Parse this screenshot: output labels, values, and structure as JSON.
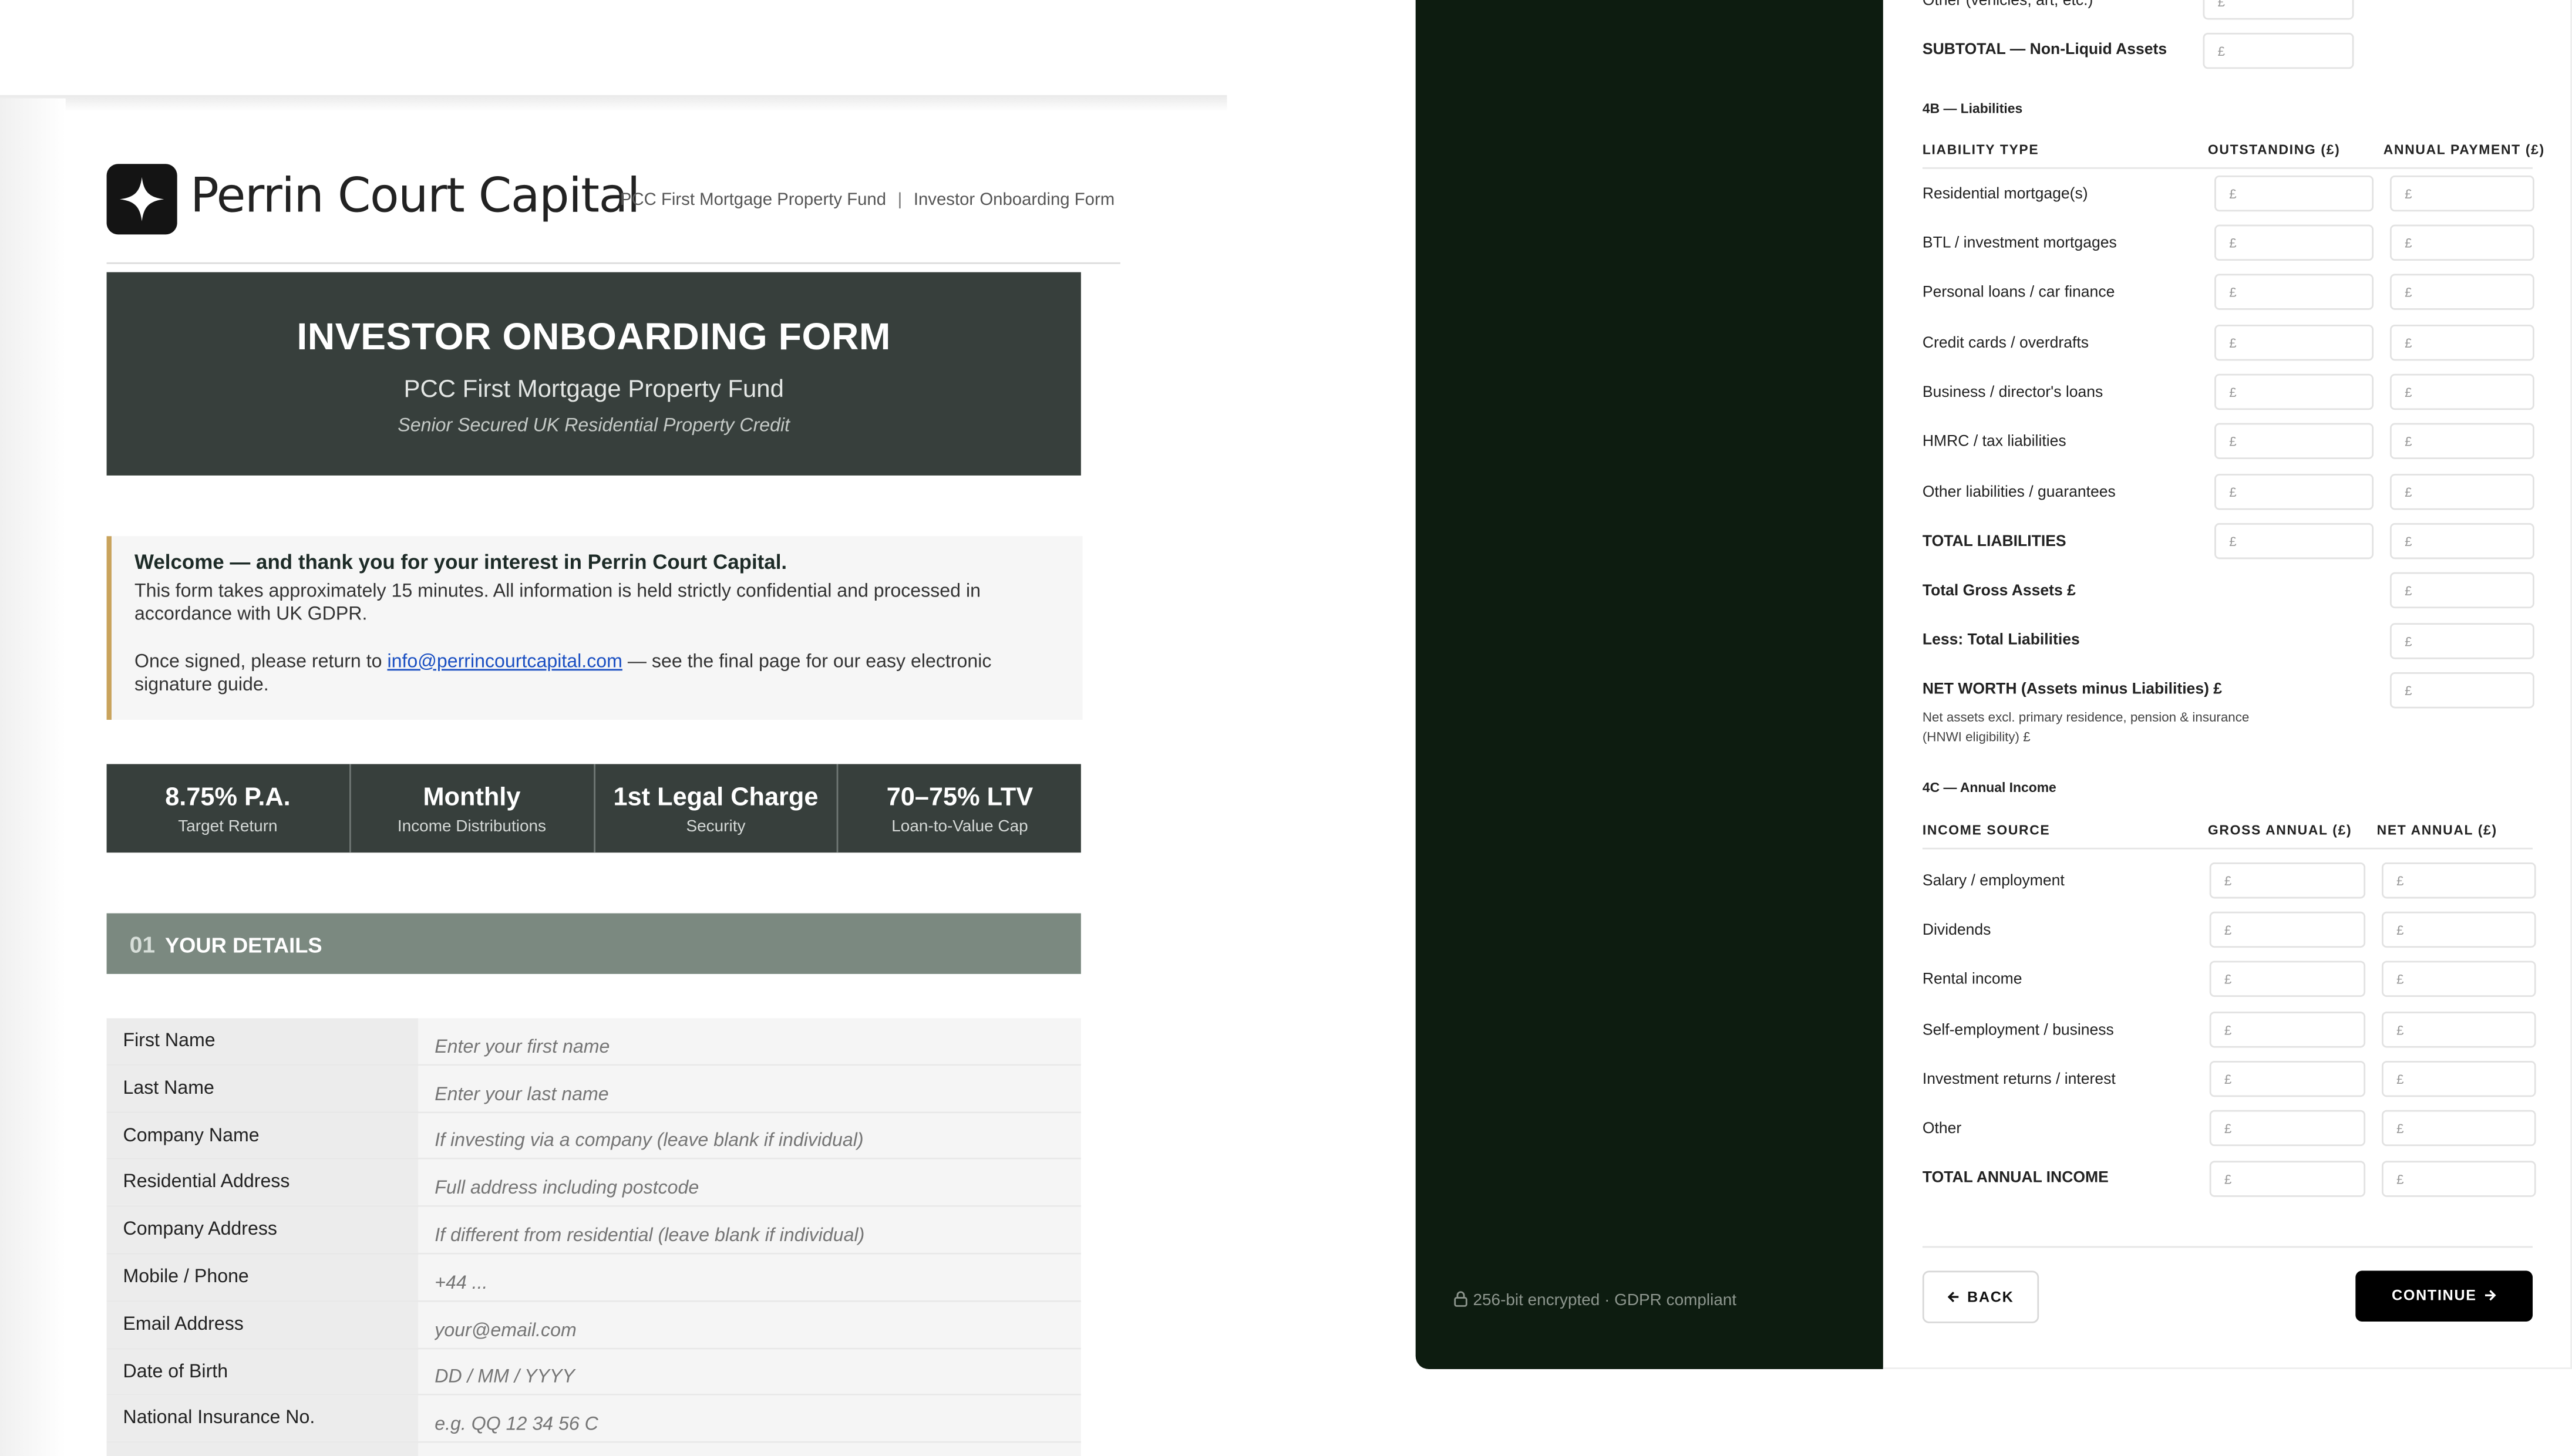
{
  "document": {
    "brand_name": "Perrin Court Capital",
    "header_fund": "PCC First Mortgage Property Fund",
    "header_separator": "|",
    "header_form": "Investor Onboarding Form",
    "banner": {
      "title": "INVESTOR ONBOARDING FORM",
      "subtitle": "PCC First Mortgage Property Fund",
      "tagline": "Senior Secured UK Residential Property Credit"
    },
    "welcome": {
      "heading": "Welcome — and thank you for your interest in Perrin Court Capital.",
      "para1": "This form takes approximately 15 minutes. All information is held strictly confidential and processed in accordance with UK GDPR.",
      "para2_before": "Once signed, please return to ",
      "email": "info@perrincourtcapital.com",
      "para2_after": " — see the final page for our easy electronic signature guide."
    },
    "stats": [
      {
        "value": "8.75% P.A.",
        "label": "Target Return"
      },
      {
        "value": "Monthly",
        "label": "Income Distributions"
      },
      {
        "value": "1st Legal Charge",
        "label": "Security"
      },
      {
        "value": "70–75% LTV",
        "label": "Loan-to-Value Cap"
      }
    ],
    "section": {
      "number": "01",
      "title": "YOUR DETAILS"
    },
    "fields": [
      {
        "label": "First Name",
        "placeholder": "Enter your first name"
      },
      {
        "label": "Last Name",
        "placeholder": "Enter your last name"
      },
      {
        "label": "Company Name",
        "placeholder": "If investing via a company (leave blank if individual)"
      },
      {
        "label": "Residential Address",
        "placeholder": "Full address including postcode"
      },
      {
        "label": "Company Address",
        "placeholder": "If different from residential (leave blank if individual)"
      },
      {
        "label": "Mobile / Phone",
        "placeholder": "+44 ..."
      },
      {
        "label": "Email Address",
        "placeholder": "your@email.com"
      },
      {
        "label": "Date of Birth",
        "placeholder": "DD / MM / YYYY"
      },
      {
        "label": "National Insurance No.",
        "placeholder": "e.g. QQ 12 34 56 C"
      }
    ]
  },
  "panel": {
    "security_note": "256-bit encrypted · GDPR compliant",
    "currency": "£",
    "top_row_label": "Other (vehicles, art, etc.)",
    "subtotal_label": "SUBTOTAL — Non-Liquid Assets",
    "liabilities": {
      "heading": "4B — Liabilities",
      "col_type": "LIABILITY TYPE",
      "col_outstanding": "OUTSTANDING (£)",
      "col_payment": "ANNUAL PAYMENT (£)",
      "rows": [
        "Residential mortgage(s)",
        "BTL / investment mortgages",
        "Personal loans / car finance",
        "Credit cards / overdrafts",
        "Business / director's loans",
        "HMRC / tax liabilities",
        "Other liabilities / guarantees"
      ],
      "total_label": "TOTAL LIABILITIES"
    },
    "summary": {
      "gross_assets": "Total Gross Assets £",
      "less_liabilities": "Less: Total Liabilities",
      "net_worth": "NET WORTH (Assets minus Liabilities) £",
      "net_note": "Net assets excl. primary residence, pension & insurance (HNWI eligibility) £"
    },
    "income": {
      "heading": "4C — Annual Income",
      "col_source": "INCOME SOURCE",
      "col_gross": "GROSS ANNUAL (£)",
      "col_net": "NET ANNUAL (£)",
      "rows": [
        "Salary / employment",
        "Dividends",
        "Rental income",
        "Self-employment / business",
        "Investment returns / interest",
        "Other"
      ],
      "total_label": "TOTAL ANNUAL INCOME"
    },
    "back_label": "BACK",
    "continue_label": "CONTINUE"
  }
}
